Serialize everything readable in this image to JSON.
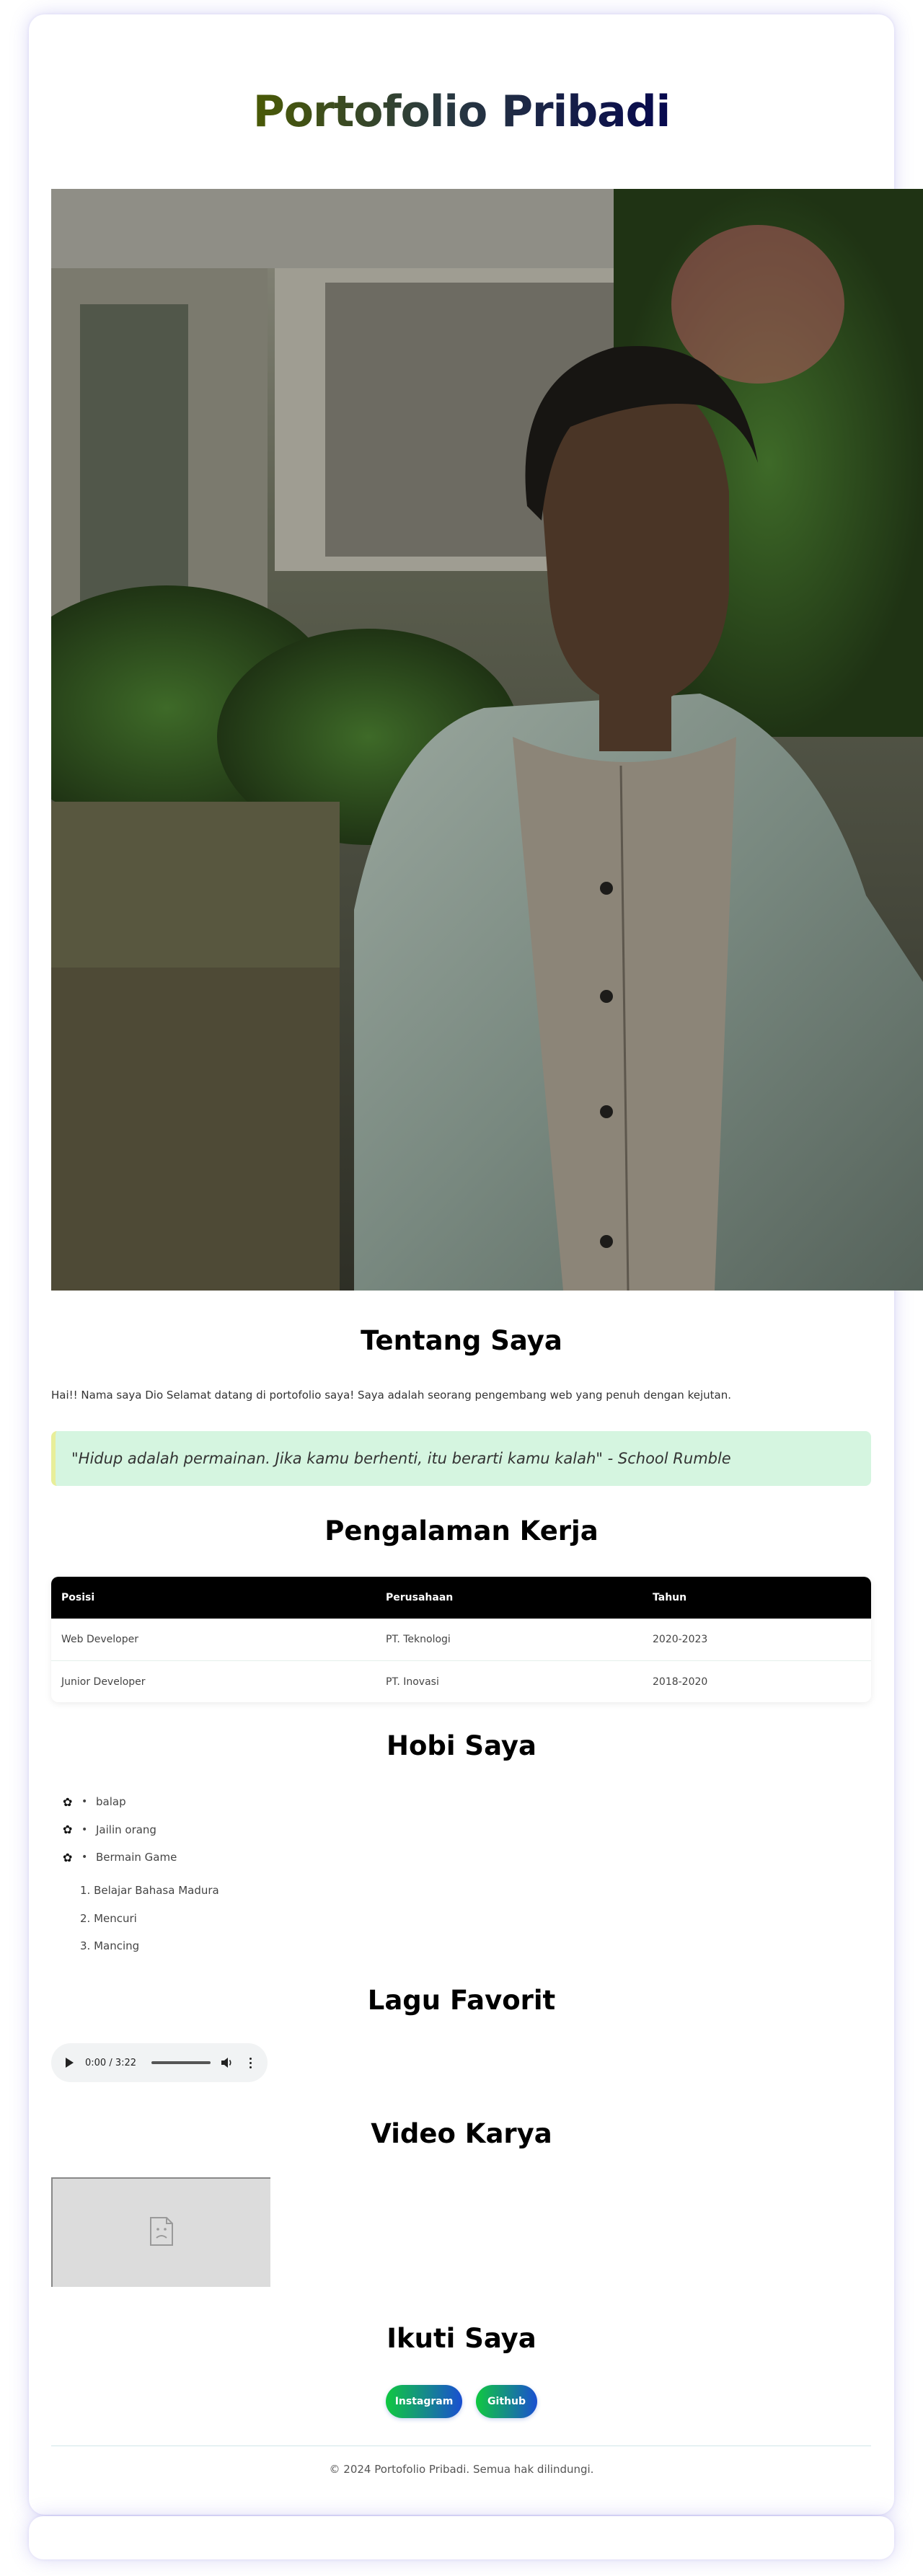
{
  "header": {
    "title": "Portofolio Pribadi"
  },
  "photo": {
    "alt": "Foto profil"
  },
  "about": {
    "heading": "Tentang Saya",
    "text": "Hai!! Nama saya Dio Selamat datang di portofolio saya! Saya adalah seorang pengembang web yang penuh dengan kejutan.",
    "quote": "\"Hidup adalah permainan. Jika kamu berhenti, itu berarti kamu kalah\" - School Rumble"
  },
  "experience": {
    "heading": "Pengalaman Kerja",
    "columns": [
      "Posisi",
      "Perusahaan",
      "Tahun"
    ],
    "rows": [
      [
        "Web Developer",
        "PT. Teknologi",
        "2020-2023"
      ],
      [
        "Junior Developer",
        "PT. Inovasi",
        "2018-2020"
      ]
    ]
  },
  "hobbies": {
    "heading": "Hobi Saya",
    "unordered": [
      "balap",
      "Jailin orang",
      "Bermain Game"
    ],
    "ordered": [
      "1. Belajar Bahasa Madura",
      "2. Mencuri",
      "3. Mancing"
    ]
  },
  "music": {
    "heading": "Lagu Favorit",
    "time": "0:00 / 3:22",
    "progress": 0
  },
  "video": {
    "heading": "Video Karya"
  },
  "social": {
    "heading": "Ikuti Saya",
    "buttons": [
      "Instagram",
      "Github"
    ]
  },
  "footer": {
    "text": "© 2024 Portofolio Pribadi. Semua hak dilindungi."
  },
  "colors": {
    "title_gradient": [
      "#4a5a05",
      "#06084e"
    ],
    "quote_bg": "#d5f5e0",
    "quote_border": "#e8ee9a",
    "table_header": "#000000",
    "button_gradient": [
      "#10c840",
      "#1a4fd1"
    ]
  }
}
